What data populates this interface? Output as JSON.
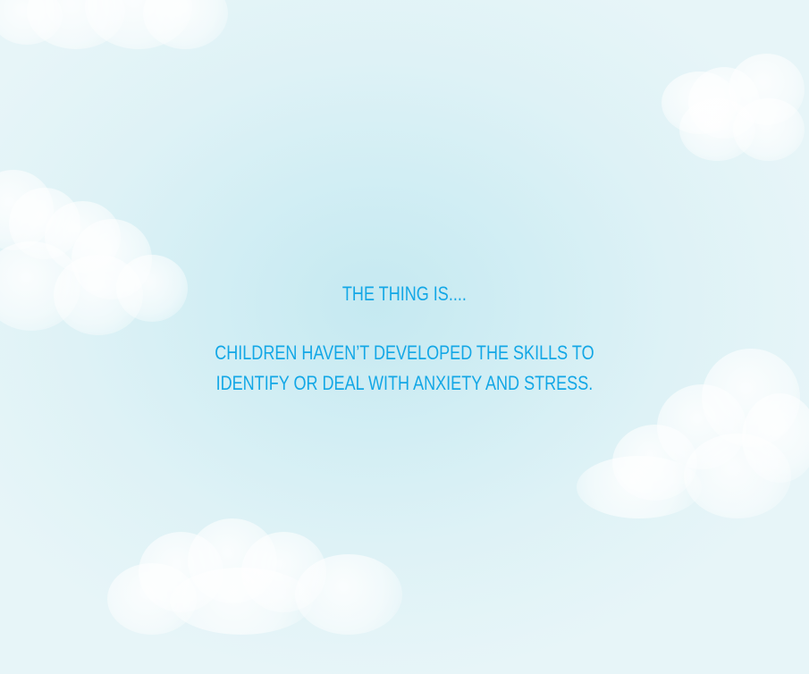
{
  "slide": {
    "heading": "THE THING IS....",
    "body_line_1": "CHILDREN HAVEN’T DEVELOPED THE SKILLS TO",
    "body_line_2": "IDENTIFY OR DEAL WITH ANXIETY AND STRESS."
  },
  "colors": {
    "text": "#13a7e6",
    "sky_center": "#c5e9f1",
    "sky_edge": "#e7f5f8"
  }
}
